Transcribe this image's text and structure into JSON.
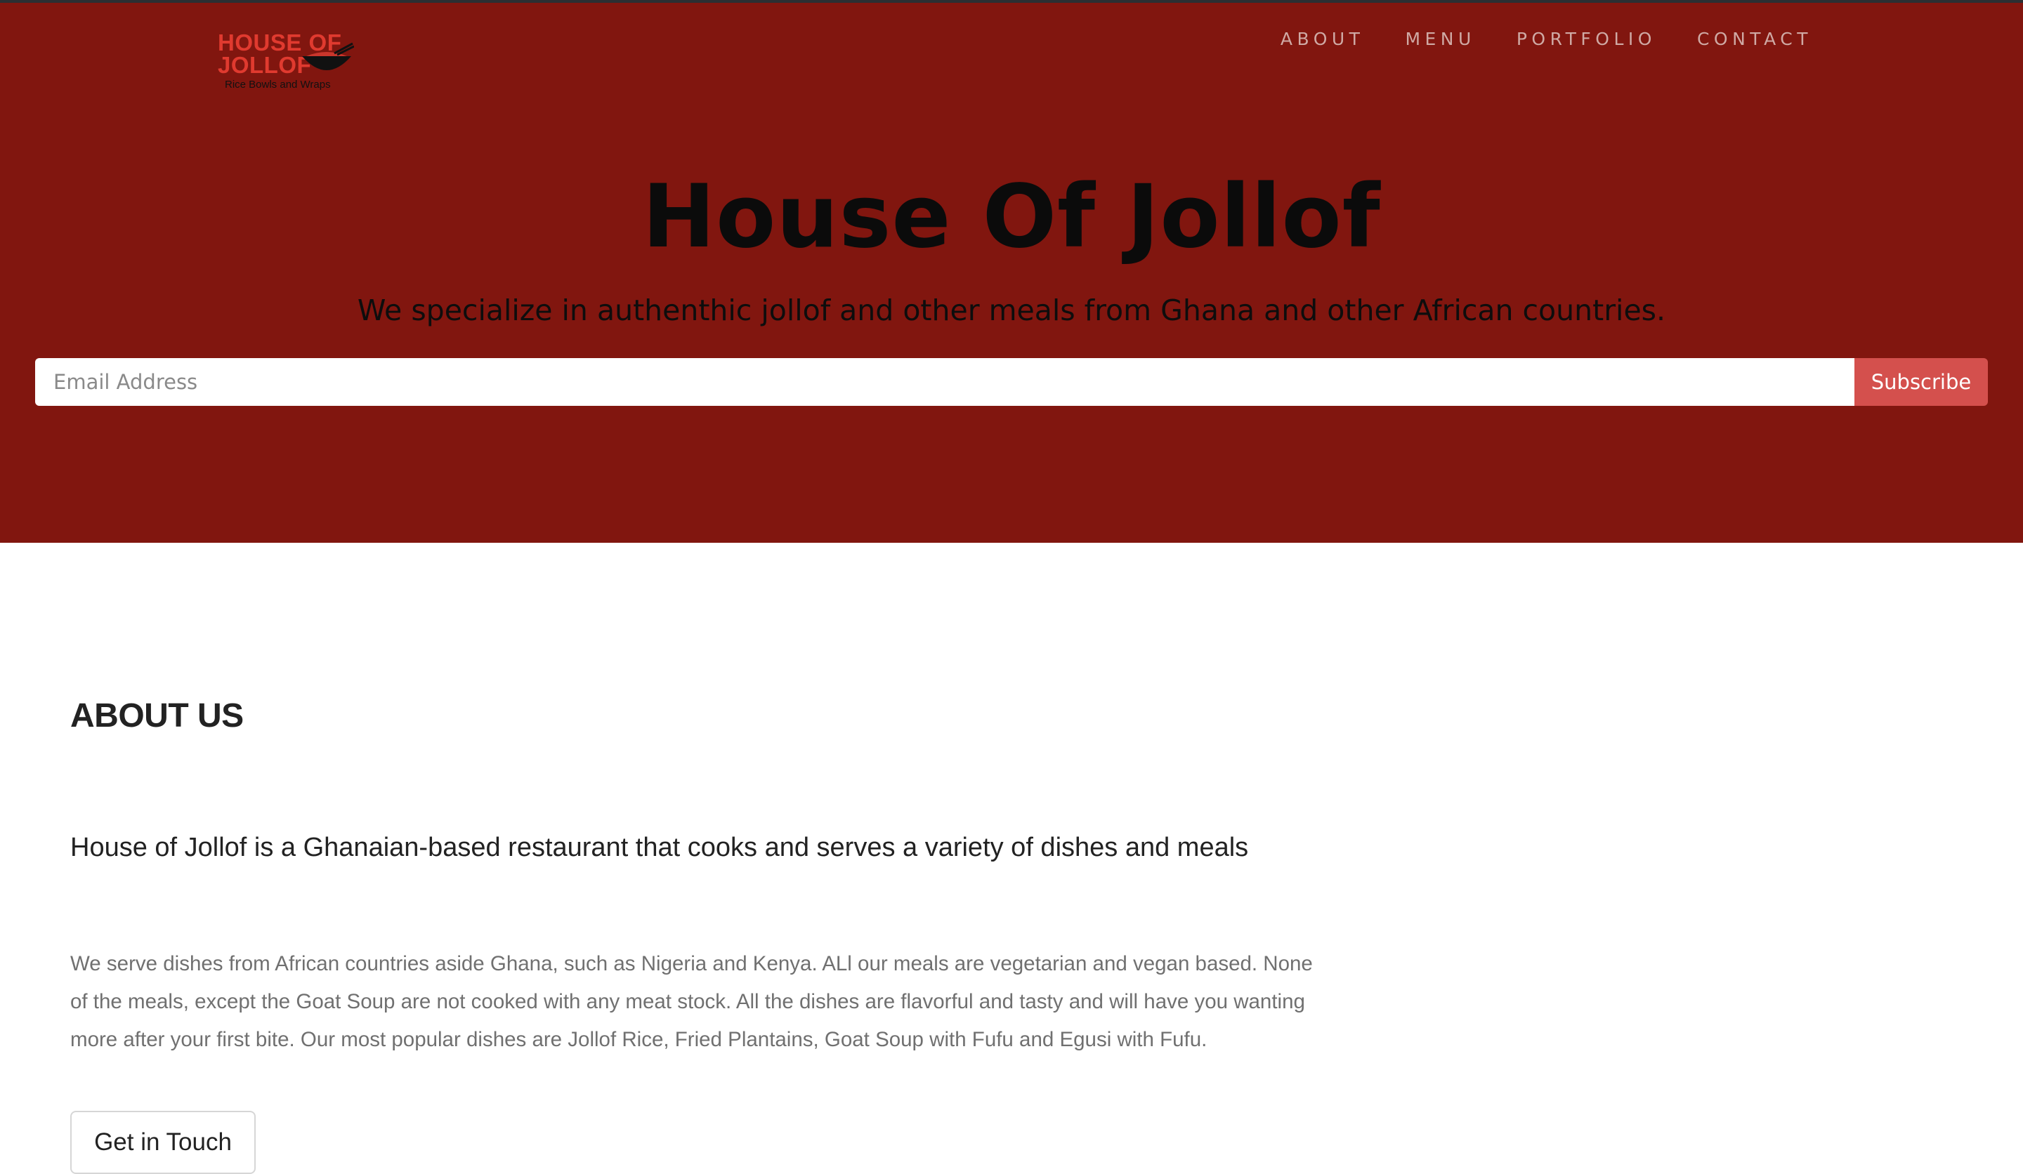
{
  "brand": {
    "logo_line1": "HOUSE OF",
    "logo_line2": "JOLLOF",
    "logo_tagline": "Rice Bowls and Wraps",
    "accent_color": "#e03a2f"
  },
  "nav": {
    "items": [
      {
        "label": "ABOUT"
      },
      {
        "label": "MENU"
      },
      {
        "label": "PORTFOLIO"
      },
      {
        "label": "CONTACT"
      }
    ]
  },
  "hero": {
    "title": "House Of Jollof",
    "subtitle": "We specialize in authenthic jollof and other meals from Ghana and other African countries.",
    "background_color": "#81160f",
    "email_placeholder": "Email Address",
    "subscribe_label": "Subscribe",
    "subscribe_color": "#d4504d"
  },
  "about": {
    "heading": "ABOUT US",
    "lead": "House of Jollof is a Ghanaian-based restaurant that cooks and serves a variety of dishes and meals",
    "body": "We serve dishes from African countries aside Ghana, such as Nigeria and Kenya. ALl our meals are vegetarian and vegan based. None of the meals, except the Goat Soup are not cooked with any meat stock. All the dishes are flavorful and tasty and will have you wanting more after your first bite. Our most popular dishes are Jollof Rice, Fried Plantains, Goat Soup with Fufu and Egusi with Fufu.",
    "cta_label": "Get in Touch"
  }
}
